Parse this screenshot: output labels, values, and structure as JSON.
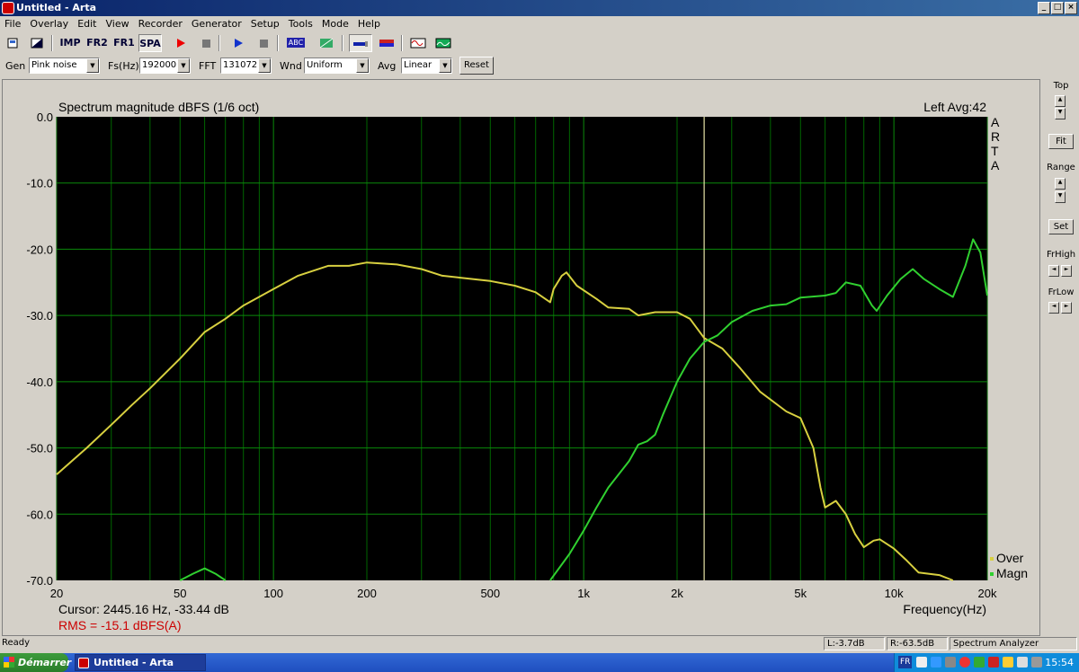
{
  "window": {
    "title": "Untitled - Arta"
  },
  "menu": [
    "File",
    "Overlay",
    "Edit",
    "View",
    "Recorder",
    "Generator",
    "Setup",
    "Tools",
    "Mode",
    "Help"
  ],
  "toolbar": {
    "imp": "IMP",
    "fr2": "FR2",
    "fr1": "FR1",
    "spa": "SPA",
    "abc": "ABC"
  },
  "params": {
    "gen_label": "Gen",
    "gen_value": "Pink noise",
    "fs_label": "Fs(Hz)",
    "fs_value": "192000",
    "fft_label": "FFT",
    "fft_value": "131072",
    "wnd_label": "Wnd",
    "wnd_value": "Uniform",
    "avg_label": "Avg",
    "avg_value": "Linear",
    "reset_label": "Reset"
  },
  "side": {
    "top_label": "Top",
    "fit_label": "Fit",
    "range_label": "Range",
    "set_label": "Set",
    "frhigh_label": "FrHigh",
    "frlow_label": "FrLow"
  },
  "chart_data": {
    "type": "line",
    "title": "Spectrum magnitude dBFS (1/6 oct)",
    "channel_info": "Left  Avg:42",
    "watermark": "ARTA",
    "xlabel": "Frequency(Hz)",
    "xscale": "log",
    "xlim": [
      20,
      20000
    ],
    "ylim": [
      -70,
      0
    ],
    "y_ticks": [
      "0.0",
      "-10.0",
      "-20.0",
      "-30.0",
      "-40.0",
      "-50.0",
      "-60.0",
      "-70.0"
    ],
    "x_ticks": [
      {
        "v": 20,
        "l": "20"
      },
      {
        "v": 50,
        "l": "50"
      },
      {
        "v": 100,
        "l": "100"
      },
      {
        "v": 200,
        "l": "200"
      },
      {
        "v": 500,
        "l": "500"
      },
      {
        "v": 1000,
        "l": "1k"
      },
      {
        "v": 2000,
        "l": "2k"
      },
      {
        "v": 5000,
        "l": "5k"
      },
      {
        "v": 10000,
        "l": "10k"
      },
      {
        "v": 20000,
        "l": "20k"
      }
    ],
    "grid": true,
    "legend_position": "bottom-right",
    "background": "#000000",
    "grid_color": "#006600",
    "cursor": {
      "freq": 2445.16,
      "db": -33.44,
      "color": "#e8e4a8"
    },
    "cursor_text": "Cursor:  2445.16 Hz, -33.44 dB",
    "rms_text": "RMS =  -15.1 dBFS(A)",
    "series": [
      {
        "name": "Over",
        "color": "#d8d040",
        "points": [
          [
            20,
            -54
          ],
          [
            25,
            -50
          ],
          [
            30,
            -46.5
          ],
          [
            35,
            -43.5
          ],
          [
            40,
            -41
          ],
          [
            50,
            -36.5
          ],
          [
            60,
            -32.5
          ],
          [
            70,
            -30.5
          ],
          [
            80,
            -28.5
          ],
          [
            100,
            -26
          ],
          [
            120,
            -24
          ],
          [
            150,
            -22.5
          ],
          [
            175,
            -22.5
          ],
          [
            200,
            -22
          ],
          [
            250,
            -22.3
          ],
          [
            300,
            -23
          ],
          [
            350,
            -24
          ],
          [
            400,
            -24.3
          ],
          [
            500,
            -24.8
          ],
          [
            600,
            -25.5
          ],
          [
            700,
            -26.5
          ],
          [
            780,
            -28
          ],
          [
            800,
            -26
          ],
          [
            850,
            -24
          ],
          [
            880,
            -23.5
          ],
          [
            950,
            -25.5
          ],
          [
            1100,
            -27.5
          ],
          [
            1200,
            -28.8
          ],
          [
            1400,
            -29
          ],
          [
            1500,
            -30
          ],
          [
            1700,
            -29.5
          ],
          [
            2000,
            -29.5
          ],
          [
            2200,
            -30.5
          ],
          [
            2445,
            -33.4
          ],
          [
            2800,
            -35
          ],
          [
            3200,
            -38
          ],
          [
            3700,
            -41.5
          ],
          [
            4500,
            -44.5
          ],
          [
            5000,
            -45.5
          ],
          [
            5500,
            -50
          ],
          [
            5800,
            -56
          ],
          [
            6000,
            -59
          ],
          [
            6500,
            -58
          ],
          [
            7000,
            -60
          ],
          [
            7500,
            -63
          ],
          [
            8000,
            -65
          ],
          [
            8600,
            -64
          ],
          [
            9000,
            -63.8
          ],
          [
            10000,
            -65.2
          ],
          [
            11000,
            -67
          ],
          [
            12000,
            -68.8
          ],
          [
            14000,
            -69.2
          ],
          [
            15500,
            -70
          ]
        ]
      },
      {
        "name": "Magn",
        "color": "#30d030",
        "points": [
          [
            50,
            -70
          ],
          [
            55,
            -69
          ],
          [
            60,
            -68.2
          ],
          [
            65,
            -69
          ],
          [
            70,
            -70
          ],
          [
            null,
            null
          ],
          [
            780,
            -70
          ],
          [
            900,
            -66
          ],
          [
            1000,
            -62.5
          ],
          [
            1100,
            -59
          ],
          [
            1200,
            -56
          ],
          [
            1400,
            -52
          ],
          [
            1500,
            -49.5
          ],
          [
            1600,
            -49
          ],
          [
            1700,
            -48
          ],
          [
            1800,
            -45
          ],
          [
            2000,
            -40
          ],
          [
            2200,
            -36.5
          ],
          [
            2445,
            -34
          ],
          [
            2700,
            -33
          ],
          [
            3000,
            -31
          ],
          [
            3500,
            -29.3
          ],
          [
            4000,
            -28.5
          ],
          [
            4500,
            -28.3
          ],
          [
            5000,
            -27.3
          ],
          [
            6000,
            -27
          ],
          [
            6500,
            -26.6
          ],
          [
            7000,
            -25
          ],
          [
            7800,
            -25.5
          ],
          [
            8500,
            -28.5
          ],
          [
            8800,
            -29.3
          ],
          [
            9500,
            -27
          ],
          [
            10500,
            -24.5
          ],
          [
            11500,
            -23
          ],
          [
            12500,
            -24.5
          ],
          [
            14000,
            -26
          ],
          [
            15500,
            -27.2
          ],
          [
            17000,
            -22.5
          ],
          [
            18000,
            -18.5
          ],
          [
            19000,
            -20.5
          ],
          [
            20000,
            -27
          ]
        ]
      }
    ]
  },
  "status": {
    "ready": "Ready",
    "l_level": "L:-3.7dB",
    "r_level": "R:-63.5dB",
    "mode": "Spectrum Analyzer"
  },
  "taskbar": {
    "start": "Démarrer",
    "task_item": "Untitled - Arta",
    "lang": "FR",
    "time": "15:54"
  }
}
